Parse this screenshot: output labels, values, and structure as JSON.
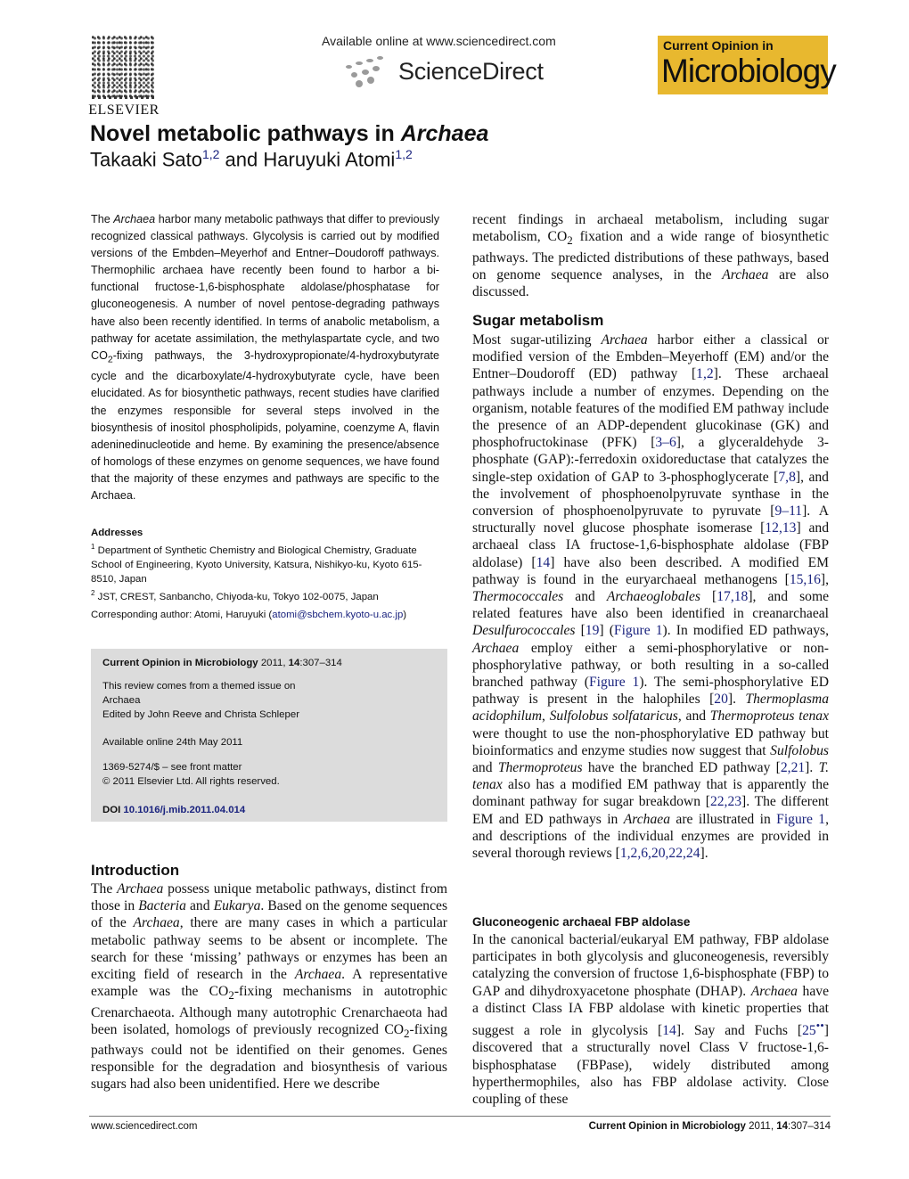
{
  "header": {
    "publisher_logo_text": "ELSEVIER",
    "available_online": "Available online at www.sciencedirect.com",
    "platform_name": "ScienceDirect",
    "journal_badge_small": "Current Opinion in",
    "journal_badge_big": "Microbiology",
    "badge_color": "#e8b82f"
  },
  "article": {
    "title_plain": "Novel metabolic pathways in ",
    "title_italic": "Archaea",
    "author1": "Takaaki Sato",
    "author1_aff": "1,2",
    "author_join": " and ",
    "author2": "Haruyuki Atomi",
    "author2_aff": "1,2"
  },
  "abstract": {
    "p1_a": "The ",
    "p1_italic": "Archaea",
    "p1_b": " harbor many metabolic pathways that differ to previously recognized classical pathways. Glycolysis is carried out by modified versions of the Embden–Meyerhof and Entner–Doudoroff pathways. Thermophilic archaea have recently been found to harbor a bi-functional fructose-1,6-bisphosphate aldolase/phosphatase for gluconeogenesis. A number of novel pentose-degrading pathways have also been recently identified. In terms of anabolic metabolism, a pathway for acetate assimilation, the methylaspartate cycle, and two CO",
    "p1_sub": "2",
    "p1_c": "-fixing pathways, the 3-hydroxypropionate/4-hydroxybutyrate cycle and the dicarboxylate/4-hydroxybutyrate cycle, have been elucidated. As for biosynthetic pathways, recent studies have clarified the enzymes responsible for several steps involved in the biosynthesis of inositol phospholipids, polyamine, coenzyme A, flavin adeninedinucleotide and heme. By examining the presence/absence of homologs of these enzymes on genome sequences, we have found that the majority of these enzymes and pathways are specific to the Archaea."
  },
  "addresses": {
    "heading": "Addresses",
    "a1_num": "1",
    "a1": " Department of Synthetic Chemistry and Biological Chemistry, Graduate School of Engineering, Kyoto University, Katsura, Nishikyo-ku, Kyoto 615-8510, Japan",
    "a2_num": "2",
    "a2": " JST, CREST, Sanbancho, Chiyoda-ku, Tokyo 102-0075, Japan",
    "corresponding_label": "Corresponding author: Atomi, Haruyuki (",
    "corresponding_email": "atomi@sbchem.kyoto-u.ac.jp",
    "corresponding_end": ")"
  },
  "info_box": {
    "journal": "Current Opinion in Microbiology",
    "year": " 2011, ",
    "volume": "14",
    "pages": ":307–314",
    "themed_issue": "This review comes from a themed issue on",
    "theme": "Archaea",
    "editors": "Edited by John Reeve and Christa Schleper",
    "available": "Available online 24th May 2011",
    "issn": "1369-5274/$ – see front matter",
    "copyright": "© 2011 Elsevier Ltd. All rights reserved.",
    "doi_label": "DOI ",
    "doi": "10.1016/j.mib.2011.04.014"
  },
  "introduction": {
    "heading": "Introduction",
    "t1": "The ",
    "i1": "Archaea",
    "t2": " possess unique metabolic pathways, distinct from those in ",
    "i2": "Bacteria",
    "t3": " and ",
    "i3": "Eukarya",
    "t4": ". Based on the genome sequences of the ",
    "i4": "Archaea",
    "t5": ", there are many cases in which a particular metabolic pathway seems to be absent or incomplete. The search for these ‘missing’ pathways or enzymes has been an exciting field of research in the ",
    "i5": "Archaea",
    "t6": ". A representative example was the CO",
    "s1": "2",
    "t7": "-fixing mechanisms in autotrophic Crenarchaeota. Although many autotrophic Crenarchaeota had been isolated, homologs of previously recognized CO",
    "s2": "2",
    "t8": "-fixing pathways could not be identified on their genomes. Genes responsible for the degradation and biosynthesis of various sugars had also been unidentified. Here we describe"
  },
  "col2_top": {
    "t1": "recent findings in archaeal metabolism, including sugar metabolism, CO",
    "s1": "2",
    "t2": " fixation and a wide range of biosynthetic pathways. The predicted distributions of these pathways, based on genome sequence analyses, in the ",
    "i1": "Archaea",
    "t3": " are also discussed."
  },
  "sugar_metabolism": {
    "heading": "Sugar metabolism",
    "t1": "Most sugar-utilizing ",
    "i1": "Archaea",
    "t2": " harbor either a classical or modified version of the Embden–Meyerhoff (EM) and/or the Entner–Doudoroff (ED) pathway [",
    "r1": "1,2",
    "t3": "]. These archaeal pathways include a number of enzymes. Depending on the organism, notable features of the modified EM pathway include the presence of an ADP-dependent glucokinase (GK) and phosphofructokinase (PFK) [",
    "r2": "3–6",
    "t4": "], a glyceraldehyde 3-phosphate (GAP):-ferredoxin oxidoreductase that catalyzes the single-step oxidation of GAP to 3-phosphoglycerate [",
    "r3": "7,8",
    "t5": "], and the involvement of phosphoenolpyruvate synthase in the conversion of phosphoenolpyruvate to pyruvate [",
    "r4": "9–11",
    "t6": "]. A structurally novel glucose phosphate isomerase [",
    "r5": "12,13",
    "t7": "] and archaeal class IA fructose-1,6-bisphosphate aldolase (FBP aldolase) [",
    "r6": "14",
    "t8": "] have also been described. A modified EM pathway is found in the euryarchaeal methanogens [",
    "r7": "15,16",
    "t9": "], ",
    "i2": "Thermococcales",
    "t10": " and ",
    "i3": "Archaeoglobales",
    "t11": " [",
    "r8": "17,18",
    "t12": "], and some related features have also been identified in creanarchaeal ",
    "i4": "Desulfurococcales",
    "t13": " [",
    "r9": "19",
    "t14": "] (",
    "f1": "Figure 1",
    "t15": "). In modified ED pathways, ",
    "i5": "Archaea",
    "t16": " employ either a semi-phosphorylative or non-phosphorylative pathway, or both resulting in a so-called branched pathway (",
    "f2": "Figure 1",
    "t17": "). The semi-phosphorylative ED pathway is present in the halophiles [",
    "r10": "20",
    "t18": "]. ",
    "i6": "Thermoplasma acidophilum",
    "t19": ", ",
    "i7": "Sulfolobus solfataricus",
    "t20": ", and ",
    "i8": "Thermoproteus tenax",
    "t21": " were thought to use the non-phosphorylative ED pathway but bioinformatics and enzyme studies now suggest that ",
    "i9": "Sulfolobus",
    "t22": " and ",
    "i10": "Thermoproteus",
    "t23": " have the branched ED pathway [",
    "r11": "2,21",
    "t24": "]. ",
    "i11": "T. tenax",
    "t25": " also has a modified EM pathway that is apparently the dominant pathway for sugar breakdown [",
    "r12": "22,23",
    "t26": "]. The different EM and ED pathways in ",
    "i12": "Archaea",
    "t27": " are illustrated in ",
    "f3": "Figure 1",
    "t28": ", and descriptions of the individual enzymes are provided in several thorough reviews [",
    "r13": "1,2,6,20,22,24",
    "t29": "]."
  },
  "gluconeogenic": {
    "heading": "Gluconeogenic archaeal FBP aldolase",
    "t1": "In the canonical bacterial/eukaryal EM pathway, FBP aldolase participates in both glycolysis and gluconeogenesis, reversibly catalyzing the conversion of fructose 1,6-bisphosphate (FBP) to GAP and dihydroxyacetone phosphate (DHAP). ",
    "i1": "Archaea",
    "t2": " have a distinct Class IA FBP aldolase with kinetic properties that suggest a role in glycolysis [",
    "r1": "14",
    "t3": "]. Say and Fuchs [",
    "r2": "25",
    "r2_mark": "••",
    "t4": "] discovered that a structurally novel Class V fructose-1,6-bisphosphatase (FBPase), widely distributed among hyperthermophiles, also has FBP aldolase activity. Close coupling of these"
  },
  "footer": {
    "left": "www.sciencedirect.com",
    "journal": "Current Opinion in Microbiology",
    "year": " 2011, ",
    "volume": "14",
    "pages": ":307–314"
  }
}
